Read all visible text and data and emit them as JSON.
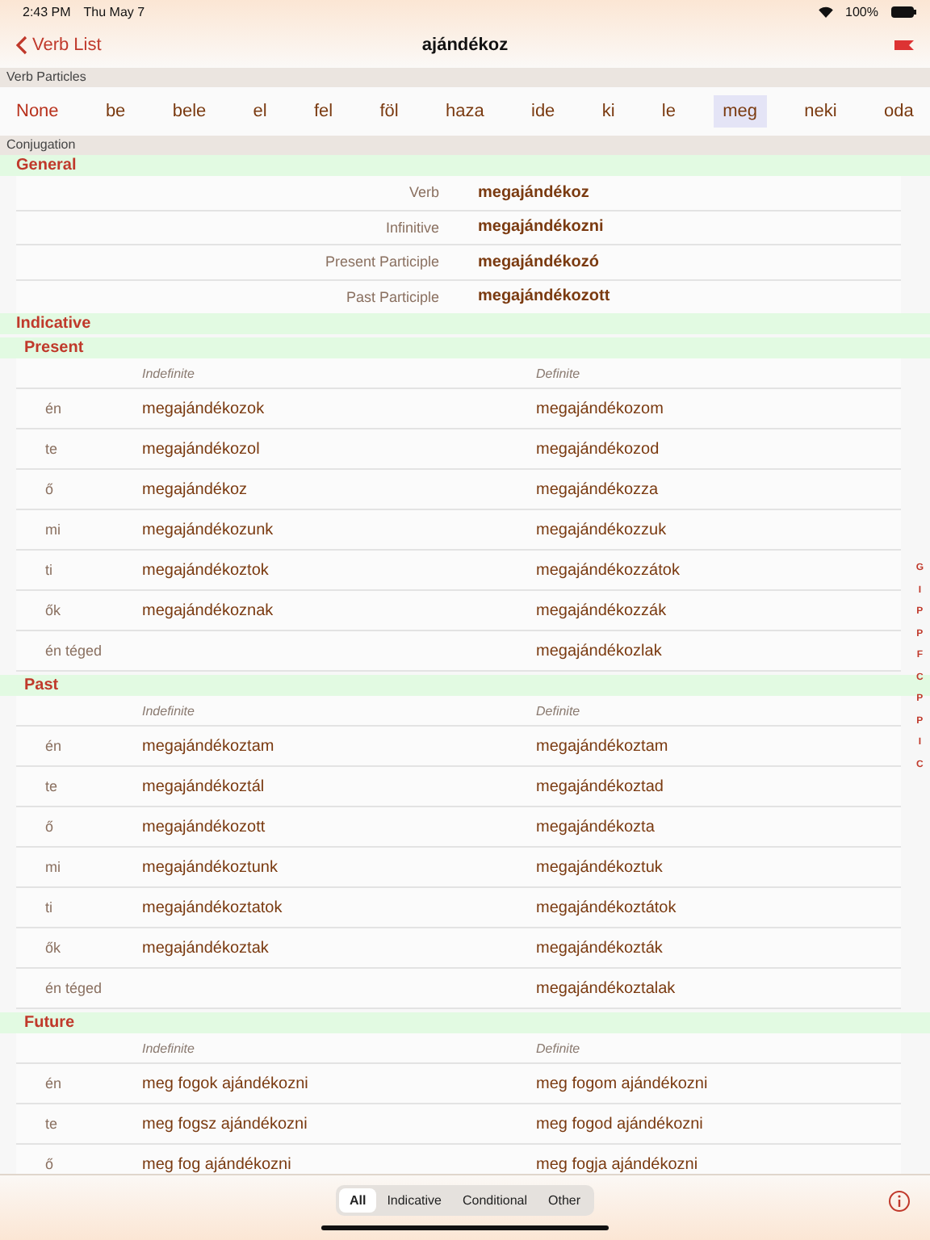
{
  "status_bar": {
    "time": "2:43 PM",
    "date": "Thu May 7",
    "battery": "100%"
  },
  "nav": {
    "back": "Verb List",
    "title": "ajándékoz"
  },
  "particles": {
    "header": "Verb Particles",
    "items": [
      {
        "label": "None",
        "selected": false,
        "kind": "none"
      },
      {
        "label": "be",
        "selected": false,
        "kind": "particle"
      },
      {
        "label": "bele",
        "selected": false,
        "kind": "particle"
      },
      {
        "label": "el",
        "selected": false,
        "kind": "particle"
      },
      {
        "label": "fel",
        "selected": false,
        "kind": "particle"
      },
      {
        "label": "föl",
        "selected": false,
        "kind": "particle"
      },
      {
        "label": "haza",
        "selected": false,
        "kind": "particle"
      },
      {
        "label": "ide",
        "selected": false,
        "kind": "particle"
      },
      {
        "label": "ki",
        "selected": false,
        "kind": "particle"
      },
      {
        "label": "le",
        "selected": false,
        "kind": "particle"
      },
      {
        "label": "meg",
        "selected": true,
        "kind": "particle"
      },
      {
        "label": "neki",
        "selected": false,
        "kind": "particle"
      },
      {
        "label": "oda",
        "selected": false,
        "kind": "particle"
      }
    ]
  },
  "conjugation": {
    "header": "Conjugation",
    "sections": [
      {
        "kind": "mood",
        "title": "General"
      },
      {
        "kind": "forms",
        "rows": [
          {
            "label": "Verb",
            "value": "megajándékoz"
          },
          {
            "label": "Infinitive",
            "value": "megajándékozni"
          },
          {
            "label": "Present Participle",
            "value": "megajándékozó"
          },
          {
            "label": "Past Participle",
            "value": "megajándékozott"
          }
        ]
      },
      {
        "kind": "mood",
        "title": "Indicative"
      },
      {
        "kind": "tense",
        "title": "Present"
      },
      {
        "kind": "table",
        "columns": [
          "Indefinite",
          "Definite"
        ],
        "rows": [
          {
            "person": "én",
            "indefinite": "megajándékozok",
            "definite": "megajándékozom"
          },
          {
            "person": "te",
            "indefinite": "megajándékozol",
            "definite": "megajándékozod"
          },
          {
            "person": "ő",
            "indefinite": "megajándékoz",
            "definite": "megajándékozza"
          },
          {
            "person": "mi",
            "indefinite": "megajándékozunk",
            "definite": "megajándékozzuk"
          },
          {
            "person": "ti",
            "indefinite": "megajándékoztok",
            "definite": "megajándékozzátok"
          },
          {
            "person": "ők",
            "indefinite": "megajándékoznak",
            "definite": "megajándékozzák"
          },
          {
            "person": "én téged",
            "definite": "megajándékozlak"
          }
        ]
      },
      {
        "kind": "tense",
        "title": "Past"
      },
      {
        "kind": "table",
        "columns": [
          "Indefinite",
          "Definite"
        ],
        "rows": [
          {
            "person": "én",
            "indefinite": "megajándékoztam",
            "definite": "megajándékoztam"
          },
          {
            "person": "te",
            "indefinite": "megajándékoztál",
            "definite": "megajándékoztad"
          },
          {
            "person": "ő",
            "indefinite": "megajándékozott",
            "definite": "megajándékozta"
          },
          {
            "person": "mi",
            "indefinite": "megajándékoztunk",
            "definite": "megajándékoztuk"
          },
          {
            "person": "ti",
            "indefinite": "megajándékoztatok",
            "definite": "megajándékoztátok"
          },
          {
            "person": "ők",
            "indefinite": "megajándékoztak",
            "definite": "megajándékozták"
          },
          {
            "person": "én téged",
            "definite": "megajándékoztalak"
          }
        ]
      },
      {
        "kind": "tense",
        "title": "Future"
      },
      {
        "kind": "table",
        "columns": [
          "Indefinite",
          "Definite"
        ],
        "rows": [
          {
            "person": "én",
            "indefinite": "meg fogok ajándékozni",
            "definite": "meg fogom ajándékozni"
          },
          {
            "person": "te",
            "indefinite": "meg fogsz ajándékozni",
            "definite": "meg fogod ajándékozni"
          },
          {
            "person": "ő",
            "indefinite": "meg fog ajándékozni",
            "definite": "meg fogja ajándékozni"
          }
        ]
      }
    ]
  },
  "index": [
    "G",
    "I",
    "P",
    "P",
    "F",
    "C",
    "P",
    "P",
    "I",
    "C"
  ],
  "filter_tabs": [
    {
      "label": "All",
      "selected": true
    },
    {
      "label": "Indicative",
      "selected": false
    },
    {
      "label": "Conditional",
      "selected": false
    },
    {
      "label": "Other",
      "selected": false
    }
  ]
}
